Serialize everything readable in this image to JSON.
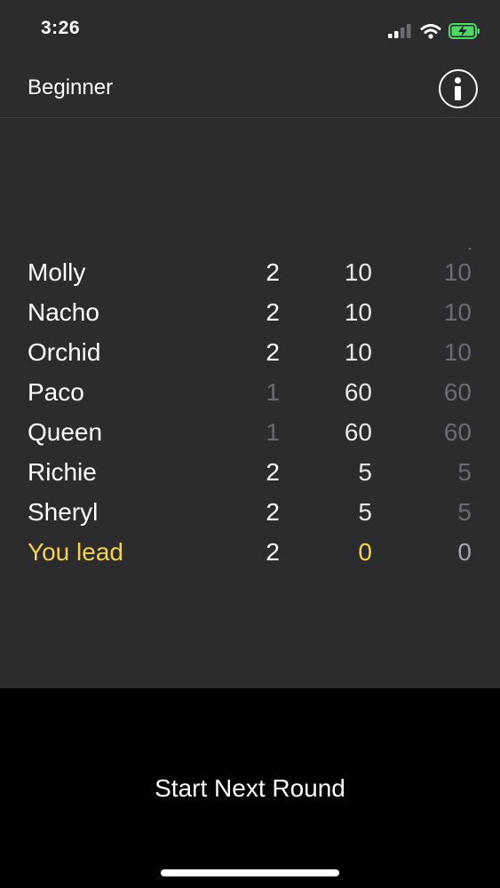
{
  "status_bar": {
    "time": "3:26",
    "icons": [
      "cellular-signal-icon",
      "wifi-icon",
      "battery-charging-icon"
    ]
  },
  "nav": {
    "title": "Beginner",
    "info_icon": "info-icon"
  },
  "scores": [
    {
      "name": "Molly",
      "round": "2",
      "points": "10",
      "total": "10",
      "round_dim": false
    },
    {
      "name": "Nacho",
      "round": "2",
      "points": "10",
      "total": "10",
      "round_dim": false
    },
    {
      "name": "Orchid",
      "round": "2",
      "points": "10",
      "total": "10",
      "round_dim": false
    },
    {
      "name": "Paco",
      "round": "1",
      "points": "60",
      "total": "60",
      "round_dim": true
    },
    {
      "name": "Queen",
      "round": "1",
      "points": "60",
      "total": "60",
      "round_dim": true
    },
    {
      "name": "Richie",
      "round": "2",
      "points": "5",
      "total": "5",
      "round_dim": false
    },
    {
      "name": "Sheryl",
      "round": "2",
      "points": "5",
      "total": "5",
      "round_dim": false
    },
    {
      "name": "You lead",
      "round": "2",
      "points": "0",
      "total": "0",
      "round_dim": false,
      "highlight": true
    }
  ],
  "actions": {
    "start_next_round": "Start Next Round"
  },
  "colors": {
    "background": "#2c2c2e",
    "bottom_background": "#000000",
    "highlight": "#f3d24f",
    "dim_text": "#6c6c70",
    "battery_green": "#4cd964"
  }
}
